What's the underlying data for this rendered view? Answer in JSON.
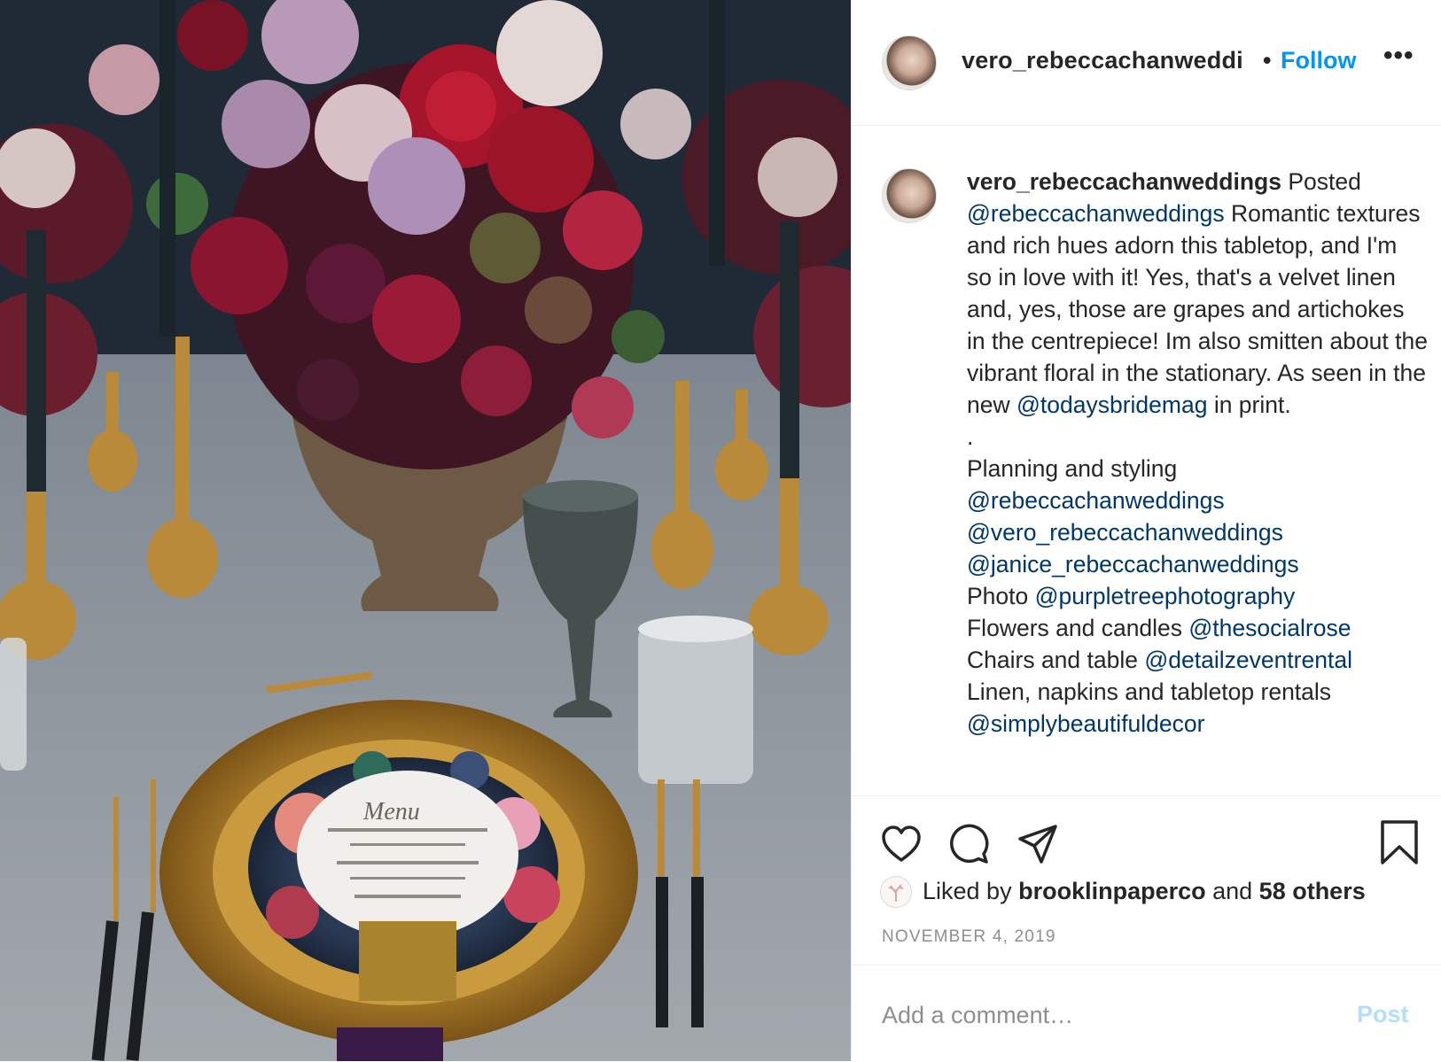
{
  "post": {
    "author": "vero_rebeccachanweddi",
    "separator": "•",
    "follow_label": "Follow",
    "more_label": "•••"
  },
  "caption": {
    "author": "vero_rebeccachanweddings",
    "segments": [
      {
        "text": " Posted\n",
        "mention": false
      },
      {
        "text": "@rebeccachanweddings",
        "mention": true
      },
      {
        "text": " Romantic textures and rich hues adorn this tabletop, and I'm so in love with it! Yes, that's a velvet linen and, yes, those are grapes and artichokes in the centrepiece! Im also smitten about the vibrant floral in the stationary. As seen in the new ",
        "mention": false
      },
      {
        "text": "@todaysbridemag",
        "mention": true
      },
      {
        "text": " in print.\n.\nPlanning and styling\n",
        "mention": false
      },
      {
        "text": "@rebeccachanweddings",
        "mention": true
      },
      {
        "text": "\n",
        "mention": false
      },
      {
        "text": "@vero_rebeccachanweddings",
        "mention": true
      },
      {
        "text": "\n",
        "mention": false
      },
      {
        "text": "@janice_rebeccachanweddings",
        "mention": true
      },
      {
        "text": "\nPhoto ",
        "mention": false
      },
      {
        "text": "@purpletreephotography",
        "mention": true
      },
      {
        "text": "\nFlowers and candles ",
        "mention": false
      },
      {
        "text": "@thesocialrose",
        "mention": true
      },
      {
        "text": "\nChairs and table ",
        "mention": false
      },
      {
        "text": "@detailzeventrental",
        "mention": true
      },
      {
        "text": "\nLinen, napkins and tabletop rentals\n",
        "mention": false
      },
      {
        "text": "@simplybeautifuldecor",
        "mention": true
      }
    ]
  },
  "likes": {
    "prefix": "Liked by ",
    "user": "brooklinpaperco",
    "middle": " and ",
    "others": "58 others"
  },
  "date": "November 4, 2019",
  "comment": {
    "placeholder": "Add a comment…",
    "post_label": "Post"
  },
  "icons": [
    "heart-icon",
    "comment-icon",
    "share-icon",
    "bookmark-icon",
    "more-options-icon"
  ],
  "colors": {
    "link_blue": "#0095f6",
    "mention_blue": "#00376b",
    "post_disabled": "#b2dffc",
    "muted": "#8e8e8e"
  }
}
